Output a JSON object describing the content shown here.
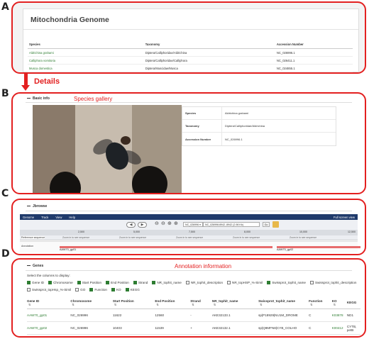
{
  "panels": {
    "a": "A",
    "b": "B",
    "c": "C",
    "d": "D"
  },
  "details_label": "Details",
  "genome": {
    "title": "Mitochondria Genome",
    "columns": [
      "Species",
      "Taxonomy",
      "Accession Number"
    ],
    "rows": [
      {
        "species": "Aldrichina grahami",
        "taxonomy": "Diptera/Calliphoridae/Aldrichina",
        "accession": "NC_026996.1"
      },
      {
        "species": "Calliphora vomitoria",
        "taxonomy": "Diptera/Calliphoridae/Calliphora",
        "accession": "NC_026411.1"
      },
      {
        "species": "Musca domestica",
        "taxonomy": "Diptera/Muscidae/Musca",
        "accession": "NC_024855.1"
      }
    ]
  },
  "basic_info": {
    "header": "Basic info",
    "caption": "Species gallery",
    "rows": [
      {
        "key": "Species",
        "value": "Aldrichina grahami"
      },
      {
        "key": "Taxonomy",
        "value": "Diptera/Calliphoridae/Aldrichina"
      },
      {
        "key": "Accession Number",
        "value": "NC_026996.1"
      }
    ]
  },
  "jbrowse": {
    "header": "Jbrowse",
    "menu": [
      "Genome",
      "Track",
      "View",
      "Help"
    ],
    "fullscreen": "Full screen view",
    "refseq_select": "NC_026996 ▾",
    "location": "NC_026996:8942..8942 (2.98 Kb)",
    "go_label": "Go",
    "ruler_ticks": [
      "2,500",
      "5,000",
      "7,500",
      "8,000",
      "10,000",
      "12,500"
    ],
    "track_refseq": "Reference sequence",
    "track_annotation": "Annotation",
    "zoom_note": "Zoom in to see sequence",
    "features": [
      "AAW70_gp01",
      "AAW70_gp02"
    ]
  },
  "genes": {
    "header": "Genes",
    "caption": "Annotation information",
    "columns_label": "Select the columns to display:",
    "checkboxes_row1": [
      {
        "label": "Gene ID",
        "on": true
      },
      {
        "label": "Chromosome",
        "on": true
      },
      {
        "label": "Start Position",
        "on": true
      },
      {
        "label": "End Position",
        "on": true
      },
      {
        "label": "Strand",
        "on": true
      },
      {
        "label": "NR_tophit_name",
        "on": true
      },
      {
        "label": "NR_tophit_description",
        "on": false
      },
      {
        "label": "NR_topHSP_%-Simil",
        "on": false
      },
      {
        "label": "Swissprot_tophit_name",
        "on": true
      },
      {
        "label": "Swissprot_tophit_description",
        "on": false
      }
    ],
    "checkboxes_row2": [
      {
        "label": "Swissprot_topHsp_%-Simil",
        "on": false
      },
      {
        "label": "GO",
        "on": false
      },
      {
        "label": "Function",
        "on": true
      },
      {
        "label": "KO",
        "on": true
      },
      {
        "label": "KEGG",
        "on": true
      }
    ],
    "table_head": [
      "Gene ID",
      "Chromosome",
      "Start Position",
      "End Position",
      "Strand",
      "NR_tophit_name",
      "Swissprot_tophit_name",
      "Function",
      "KO",
      "KEGG"
    ],
    "rows": [
      {
        "gene_id": "AAW70_gp01",
        "chromosome": "NC_026996",
        "start": "11622",
        "end": "12560",
        "strand": "-",
        "nr": "AKE32133.1",
        "swiss": "sp|P18929|NU1M_DROME",
        "function": "C",
        "ko": "K03878",
        "kegg": "ND1"
      },
      {
        "gene_id": "AAW70_gp02",
        "chromosome": "NC_026996",
        "start": "10403",
        "end": "11539",
        "strand": "+",
        "nr": "AKE32132.1",
        "swiss": "sp|Q9MFN8|CYB_COLHO",
        "function": "C",
        "ko": "K00412",
        "kegg": "CYTB, petB"
      }
    ]
  },
  "colors": {
    "highlight_red": "#e32020",
    "link_green": "#2e7d32",
    "jbrowse_bar": "#1f3a6b"
  }
}
